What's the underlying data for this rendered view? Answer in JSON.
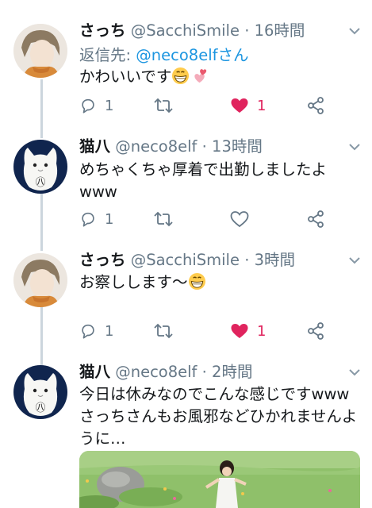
{
  "tweets": [
    {
      "name": "さっち",
      "handle": "@SacchiSmile",
      "dot": "·",
      "time": "16時間",
      "reply_label": "返信先:",
      "reply_handle": "@neco8elfさん",
      "text": "かわいいです",
      "emoji": [
        "grin",
        "two-hearts"
      ],
      "reply_count": "1",
      "retweet_count": "",
      "like_count": "1",
      "liked": true
    },
    {
      "name": "猫八",
      "handle": "@neco8elf",
      "dot": "·",
      "time": "13時間",
      "text_lines": [
        "めちゃくちゃ厚着で出勤しましたよ",
        "www"
      ],
      "reply_count": "1",
      "retweet_count": "",
      "like_count": "",
      "liked": false
    },
    {
      "name": "さっち",
      "handle": "@SacchiSmile",
      "dot": "·",
      "time": "3時間",
      "text": "お察しします〜",
      "emoji": [
        "grin"
      ],
      "reply_count": "1",
      "retweet_count": "",
      "like_count": "1",
      "liked": true
    },
    {
      "name": "猫八",
      "handle": "@neco8elf",
      "dot": "·",
      "time": "2時間",
      "text_lines": [
        "今日は休みなのでこんな感じですwww",
        "さっちさんもお風邪などひかれませんよ",
        "うに…"
      ]
    }
  ],
  "colors": {
    "like_active": "#e0245e",
    "link": "#1b95e0",
    "secondary_text": "#657786",
    "thread_line": "#ccd6dd"
  },
  "icons": [
    "reply-icon",
    "retweet-icon",
    "like-icon",
    "share-icon",
    "chevron-down-icon"
  ]
}
